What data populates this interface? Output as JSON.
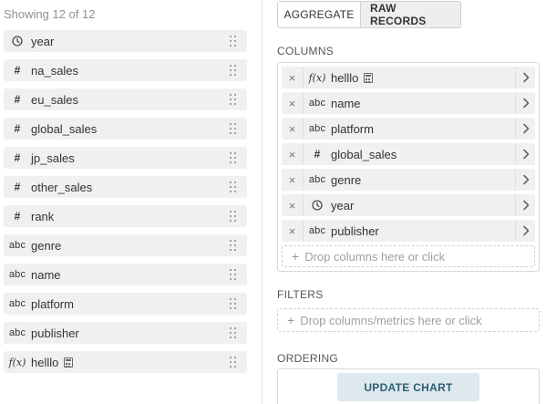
{
  "left_panel": {
    "showing_text": "Showing 12 of 12",
    "columns": [
      {
        "type": "time",
        "name": "year"
      },
      {
        "type": "numeric",
        "name": "na_sales"
      },
      {
        "type": "numeric",
        "name": "eu_sales"
      },
      {
        "type": "numeric",
        "name": "global_sales"
      },
      {
        "type": "numeric",
        "name": "jp_sales"
      },
      {
        "type": "numeric",
        "name": "other_sales"
      },
      {
        "type": "numeric",
        "name": "rank"
      },
      {
        "type": "string",
        "name": "genre"
      },
      {
        "type": "string",
        "name": "name"
      },
      {
        "type": "string",
        "name": "platform"
      },
      {
        "type": "string",
        "name": "publisher"
      },
      {
        "type": "function",
        "name": "helllo",
        "calculated": true
      }
    ]
  },
  "type_glyphs": {
    "numeric": "#",
    "string": "abc",
    "function": "f(x)"
  },
  "tabs": [
    {
      "label": "AGGREGATE",
      "active": false
    },
    {
      "label": "RAW RECORDS",
      "active": true
    }
  ],
  "columns_section": {
    "label": "COLUMNS",
    "selected": [
      {
        "type": "function",
        "name": "helllo",
        "calculated": true
      },
      {
        "type": "string",
        "name": "name"
      },
      {
        "type": "string",
        "name": "platform"
      },
      {
        "type": "numeric",
        "name": "global_sales"
      },
      {
        "type": "string",
        "name": "genre"
      },
      {
        "type": "time",
        "name": "year"
      },
      {
        "type": "string",
        "name": "publisher"
      }
    ],
    "drop_placeholder": "Drop columns here or click"
  },
  "filters_section": {
    "label": "FILTERS",
    "drop_placeholder": "Drop columns/metrics here or click"
  },
  "ordering_section": {
    "label": "ORDERING"
  },
  "update_button": {
    "label": "UPDATE CHART"
  },
  "colors": {
    "item_bg": "#f0f0f0",
    "update_bg": "#dde9ee",
    "update_text": "#2f5f73",
    "muted_text": "#909090"
  }
}
